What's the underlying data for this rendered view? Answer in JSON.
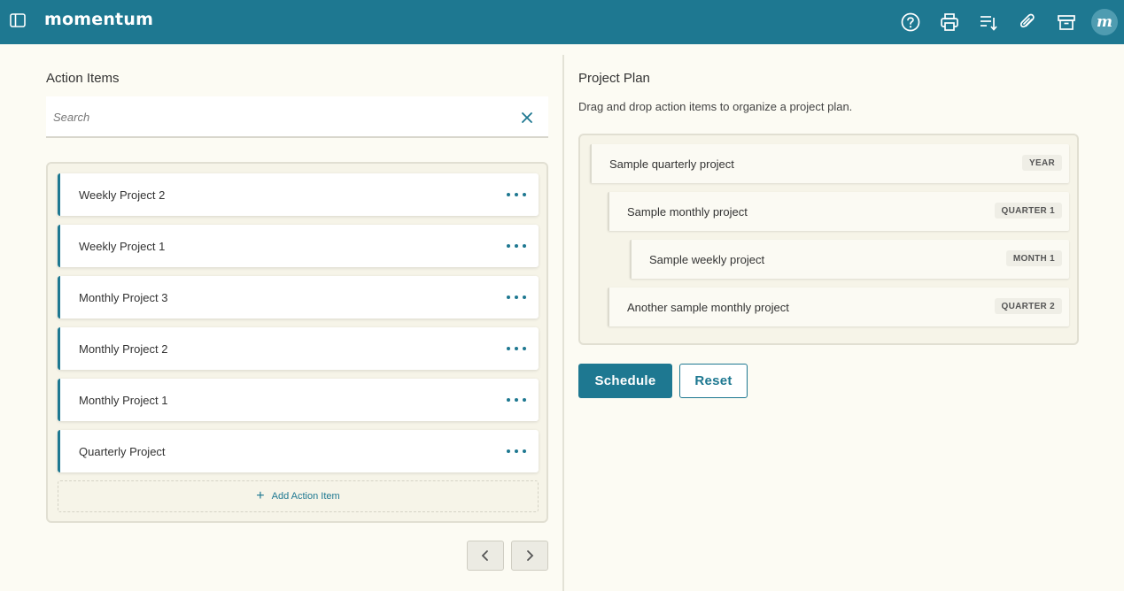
{
  "app": {
    "name": "momentum",
    "avatar_letter": "m",
    "accent_color": "#1e7891"
  },
  "header": {
    "icons": [
      "sidebar-toggle-icon",
      "help-icon",
      "print-icon",
      "sort-list-icon",
      "attachment-icon",
      "archive-icon"
    ]
  },
  "action_items": {
    "title": "Action Items",
    "search_placeholder": "Search",
    "search_value": "",
    "items": [
      {
        "label": "Weekly Project 2"
      },
      {
        "label": "Weekly Project 1"
      },
      {
        "label": "Monthly Project 3"
      },
      {
        "label": "Monthly Project 2"
      },
      {
        "label": "Monthly Project 1"
      },
      {
        "label": "Quarterly Project"
      }
    ],
    "add_label": "Add Action Item"
  },
  "project_plan": {
    "title": "Project Plan",
    "subtitle": "Drag and drop action items to organize a project plan.",
    "items": [
      {
        "label": "Sample quarterly project",
        "badge": "YEAR",
        "level": 0
      },
      {
        "label": "Sample monthly project",
        "badge": "QUARTER 1",
        "level": 1
      },
      {
        "label": "Sample weekly project",
        "badge": "MONTH 1",
        "level": 2
      },
      {
        "label": "Another sample monthly project",
        "badge": "QUARTER 2",
        "level": 1
      }
    ],
    "schedule_label": "Schedule",
    "reset_label": "Reset"
  }
}
